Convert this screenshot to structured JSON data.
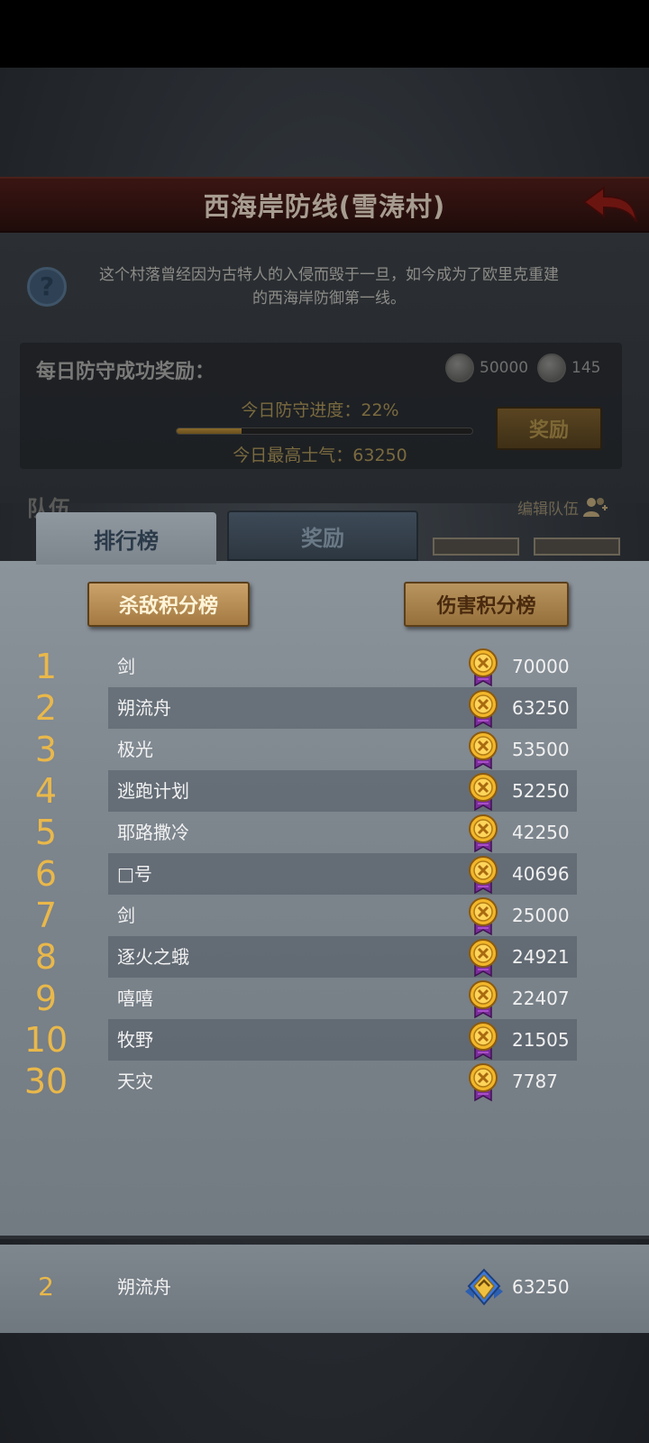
{
  "header": {
    "title": "西海岸防线(雪涛村)",
    "description_line1": "这个村落曾经因为古特人的入侵而毁于一旦，如今成为了欧里克重建",
    "description_line2": "的西海岸防御第一线。"
  },
  "daily_reward": {
    "label": "每日防守成功奖励：",
    "resource1": "50000",
    "resource2": "145",
    "progress_text": "今日防守进度：22%",
    "progress_fraction": 0.22,
    "morale_text": "今日最高士气：63250",
    "reward_button": "奖励"
  },
  "team": {
    "label": "队伍",
    "edit_label": "编辑队伍"
  },
  "tabs": {
    "ranking": "排行榜",
    "rewards": "奖励"
  },
  "boards": {
    "kill": "杀敌积分榜",
    "damage": "伤害积分榜"
  },
  "ranking": [
    {
      "rank": "1",
      "name": "剑",
      "score": "70000"
    },
    {
      "rank": "2",
      "name": "朔流舟",
      "score": "63250"
    },
    {
      "rank": "3",
      "name": "极光",
      "score": "53500"
    },
    {
      "rank": "4",
      "name": "逃跑计划",
      "score": "52250"
    },
    {
      "rank": "5",
      "name": "耶路撒冷",
      "score": "42250"
    },
    {
      "rank": "6",
      "name": "□号",
      "score": "40696"
    },
    {
      "rank": "7",
      "name": "剑",
      "score": "25000"
    },
    {
      "rank": "8",
      "name": "逐火之蛾",
      "score": "24921"
    },
    {
      "rank": "9",
      "name": "嘻嘻",
      "score": "22407"
    },
    {
      "rank": "10",
      "name": "牧野",
      "score": "21505"
    },
    {
      "rank": "30",
      "name": "天灾",
      "score": "7787"
    }
  ],
  "my_rank": {
    "rank": "2",
    "name": "朔流舟",
    "score": "63250"
  }
}
